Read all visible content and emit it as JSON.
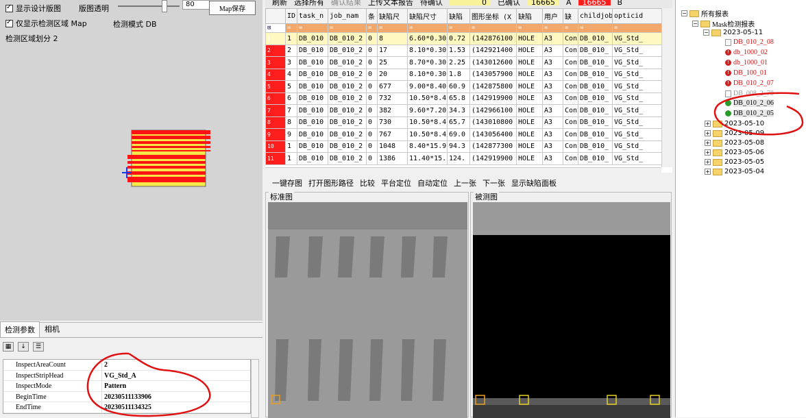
{
  "left": {
    "show_design_map": "显示设计版图",
    "map_opacity": "版图透明",
    "opacity_value": "80",
    "map_save": "Map保存",
    "only_detect_area": "仅显示检测区域 Map",
    "detect_mode": "检测模式 DB",
    "area_split": "检测区域划分 2"
  },
  "props": {
    "tabs": [
      "检测参数",
      "相机"
    ],
    "rows": [
      {
        "k": "InspectAreaCount",
        "v": "2"
      },
      {
        "k": "InspectStripHead",
        "v": "VG_Std_A"
      },
      {
        "k": "InspectMode",
        "v": "Pattern"
      },
      {
        "k": "BeginTime",
        "v": "20230511133906"
      },
      {
        "k": "EndTime",
        "v": "20230511134325"
      }
    ]
  },
  "grid": {
    "toolbar": {
      "refresh": "刷新",
      "select_all": "选择所有",
      "confirm": "确认结果",
      "upload": "上传文本报告",
      "pending": "待确认",
      "pending_count": "0",
      "confirmed": "已确认",
      "confirmed_count": "16665",
      "a": "A",
      "a_count": "16665",
      "b": "B"
    },
    "headers": [
      "ID",
      "task_n",
      "job_nam",
      "条",
      "缺陷尺",
      "缺陷尺寸",
      "缺陷",
      "图形坐标 (X",
      "缺陷",
      "用户",
      "缺",
      "childjob",
      "opticid"
    ],
    "rows": [
      [
        "1",
        "DB_010",
        "DB_010_2",
        "0",
        "8",
        "6.60*0.30",
        "0.72",
        "(142876100",
        "HOLE",
        "A3",
        "Con",
        "DB_010_",
        "VG_Std_"
      ],
      [
        "2",
        "DB_010",
        "DB_010_2",
        "0",
        "17",
        "8.10*0.30",
        "1.53",
        "(142921400",
        "HOLE",
        "A3",
        "Con",
        "DB_010_",
        "VG_Std_"
      ],
      [
        "3",
        "DB_010",
        "DB_010_2",
        "0",
        "25",
        "8.70*0.30",
        "2.25",
        "(143012600",
        "HOLE",
        "A3",
        "Con",
        "DB_010_",
        "VG_Std_"
      ],
      [
        "4",
        "DB_010",
        "DB_010_2",
        "0",
        "20",
        "8.10*0.30",
        "1.8",
        "(143057900",
        "HOLE",
        "A3",
        "Con",
        "DB_010_",
        "VG_Std_"
      ],
      [
        "5",
        "DB_010",
        "DB_010_2",
        "0",
        "677",
        "9.00*8.40",
        "60.9",
        "(142875800",
        "HOLE",
        "A3",
        "Con",
        "DB_010_",
        "VG_Std_"
      ],
      [
        "6",
        "DB_010",
        "DB_010_2",
        "0",
        "732",
        "10.50*8.4",
        "65.8",
        "(142919900",
        "HOLE",
        "A3",
        "Con",
        "DB_010_",
        "VG_Std_"
      ],
      [
        "7",
        "DB_010",
        "DB_010_2",
        "0",
        "382",
        "9.60*7.20",
        "34.3",
        "(142966100",
        "HOLE",
        "A3",
        "Con",
        "DB_010_",
        "VG_Std_"
      ],
      [
        "8",
        "DB_010",
        "DB_010_2",
        "0",
        "730",
        "10.50*8.4",
        "65.7",
        "(143010800",
        "HOLE",
        "A3",
        "Con",
        "DB_010_",
        "VG_Std_"
      ],
      [
        "9",
        "DB_010",
        "DB_010_2",
        "0",
        "767",
        "10.50*8.4",
        "69.0",
        "(143056400",
        "HOLE",
        "A3",
        "Con",
        "DB_010_",
        "VG_Std_"
      ],
      [
        "1",
        "DB_010",
        "DB_010_2",
        "0",
        "1048",
        "8.40*15.9",
        "94.3",
        "(142877300",
        "HOLE",
        "A3",
        "Con",
        "DB_010_",
        "VG_Std_"
      ],
      [
        "1",
        "DB_010",
        "DB_010_2",
        "0",
        "1386",
        "11.40*15.",
        "124.",
        "(142919900",
        "HOLE",
        "A3",
        "Con",
        "DB_010_",
        "VG_Std_"
      ]
    ],
    "row_heads": [
      "1",
      "2",
      "3",
      "4",
      "5",
      "6",
      "7",
      "8",
      "9",
      "10",
      "11"
    ],
    "filter_mark": "="
  },
  "img_tools": [
    "一键存图",
    "打开图形路径",
    "比较",
    "平台定位",
    "自动定位",
    "上一张",
    "下一张",
    "显示缺陷面板"
  ],
  "panels": {
    "std": "标准图",
    "meas": "被测图"
  },
  "tree": {
    "root": "所有报表",
    "mask": "Mask检测报表",
    "dates": [
      "2023-05-11",
      "2023-05-10",
      "2023-05-09",
      "2023-05-08",
      "2023-05-06",
      "2023-05-05",
      "2023-05-04"
    ],
    "jobs": [
      "DB_010_2_08",
      "db_1000_02",
      "db_1000_01",
      "DB_100_01",
      "DB_010_2_07",
      "DB_008_2_78",
      "DB_010_2_06",
      "DB_010_2_05"
    ]
  },
  "colors": {
    "accent_red": "#ff1e1e",
    "filter_orange": "#f2a86a",
    "count_yellow": "#f8f39a",
    "annotation_red": "#e01010"
  }
}
